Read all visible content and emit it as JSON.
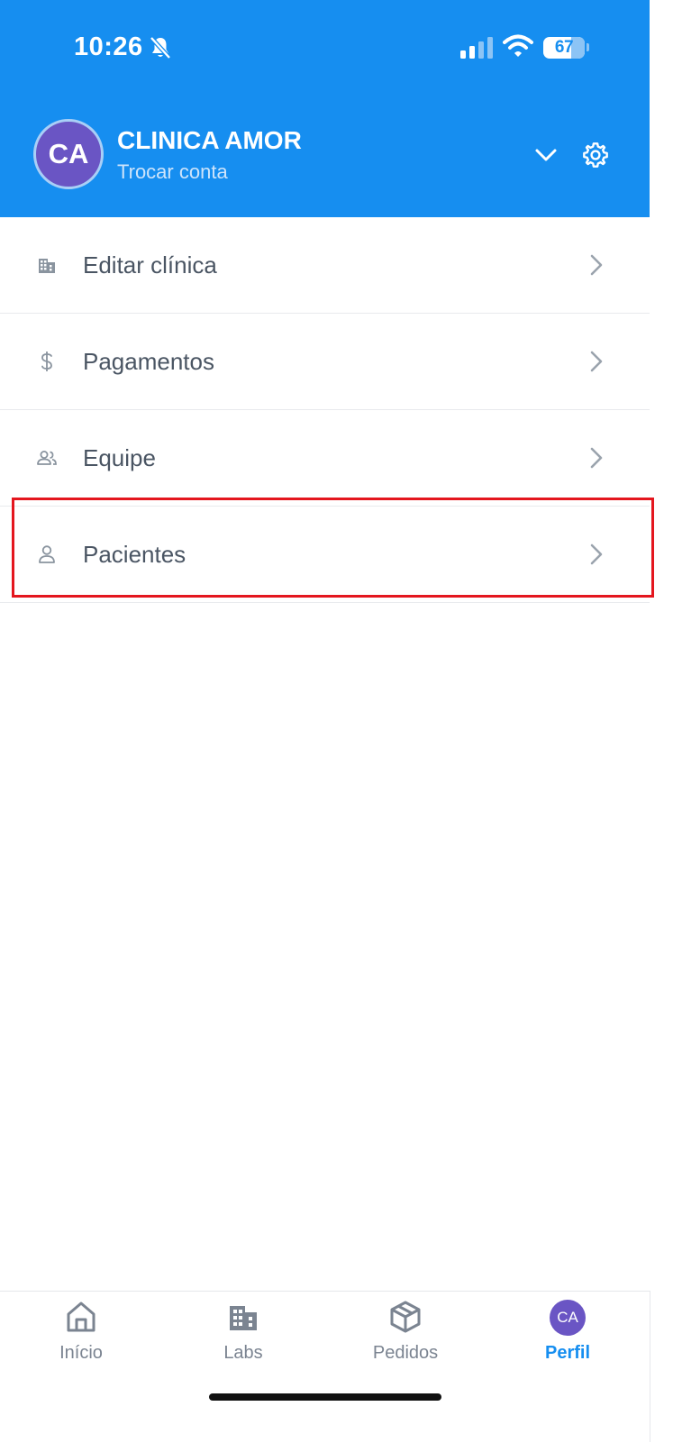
{
  "status_bar": {
    "time": "10:26",
    "battery": "67"
  },
  "header": {
    "avatar_initials": "CA",
    "clinic_name": "CLINICA AMOR",
    "switch_account": "Trocar conta"
  },
  "menu": {
    "items": [
      {
        "label": "Editar clínica",
        "icon": "building-icon"
      },
      {
        "label": "Pagamentos",
        "icon": "dollar-icon"
      },
      {
        "label": "Equipe",
        "icon": "team-icon"
      },
      {
        "label": "Pacientes",
        "icon": "person-icon",
        "highlighted": true
      }
    ]
  },
  "tabbar": {
    "tabs": [
      {
        "label": "Início",
        "icon": "home-icon"
      },
      {
        "label": "Labs",
        "icon": "building-icon"
      },
      {
        "label": "Pedidos",
        "icon": "box-icon"
      },
      {
        "label": "Perfil",
        "avatar": "CA",
        "active": true
      }
    ]
  },
  "colors": {
    "primary": "#168ef0",
    "avatar": "#6a55c4",
    "highlight": "#e4161e"
  }
}
